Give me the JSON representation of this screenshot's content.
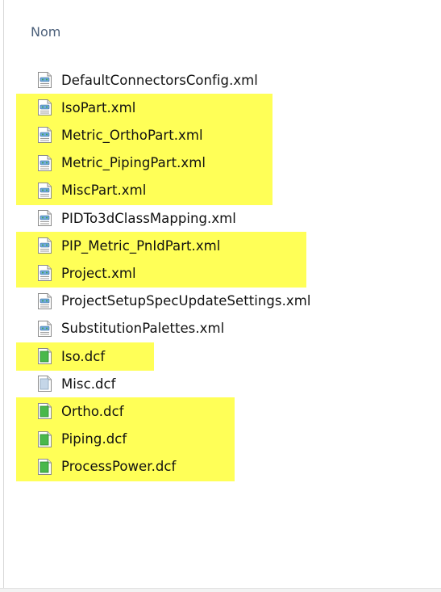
{
  "header": {
    "column_name": "Nom"
  },
  "files": [
    {
      "name": "DefaultConnectorsConfig.xml",
      "icon": "xml-file-icon",
      "highlighted": false
    },
    {
      "name": "IsoPart.xml",
      "icon": "xml-file-icon",
      "highlighted": true
    },
    {
      "name": "Metric_OrthoPart.xml",
      "icon": "xml-file-icon",
      "highlighted": true
    },
    {
      "name": "Metric_PipingPart.xml",
      "icon": "xml-file-icon",
      "highlighted": true
    },
    {
      "name": "MiscPart.xml",
      "icon": "xml-file-icon",
      "highlighted": true
    },
    {
      "name": "PIDTo3dClassMapping.xml",
      "icon": "xml-file-icon",
      "highlighted": false
    },
    {
      "name": "PIP_Metric_PnIdPart.xml",
      "icon": "xml-file-icon",
      "highlighted": true
    },
    {
      "name": "Project.xml",
      "icon": "xml-file-icon",
      "highlighted": true
    },
    {
      "name": "ProjectSetupSpecUpdateSettings.xml",
      "icon": "xml-file-icon",
      "highlighted": false
    },
    {
      "name": "SubstitutionPalettes.xml",
      "icon": "xml-file-icon",
      "highlighted": false
    },
    {
      "name": "Iso.dcf",
      "icon": "dcf-file-icon",
      "highlighted": true
    },
    {
      "name": "Misc.dcf",
      "icon": "dcf-file-icon",
      "highlighted": false
    },
    {
      "name": "Ortho.dcf",
      "icon": "dcf-file-icon",
      "highlighted": true
    },
    {
      "name": "Piping.dcf",
      "icon": "dcf-file-icon",
      "highlighted": true
    },
    {
      "name": "ProcessPower.dcf",
      "icon": "dcf-file-icon",
      "highlighted": true
    }
  ],
  "colors": {
    "highlight": "#ffff57",
    "header_text": "#4c607a"
  }
}
